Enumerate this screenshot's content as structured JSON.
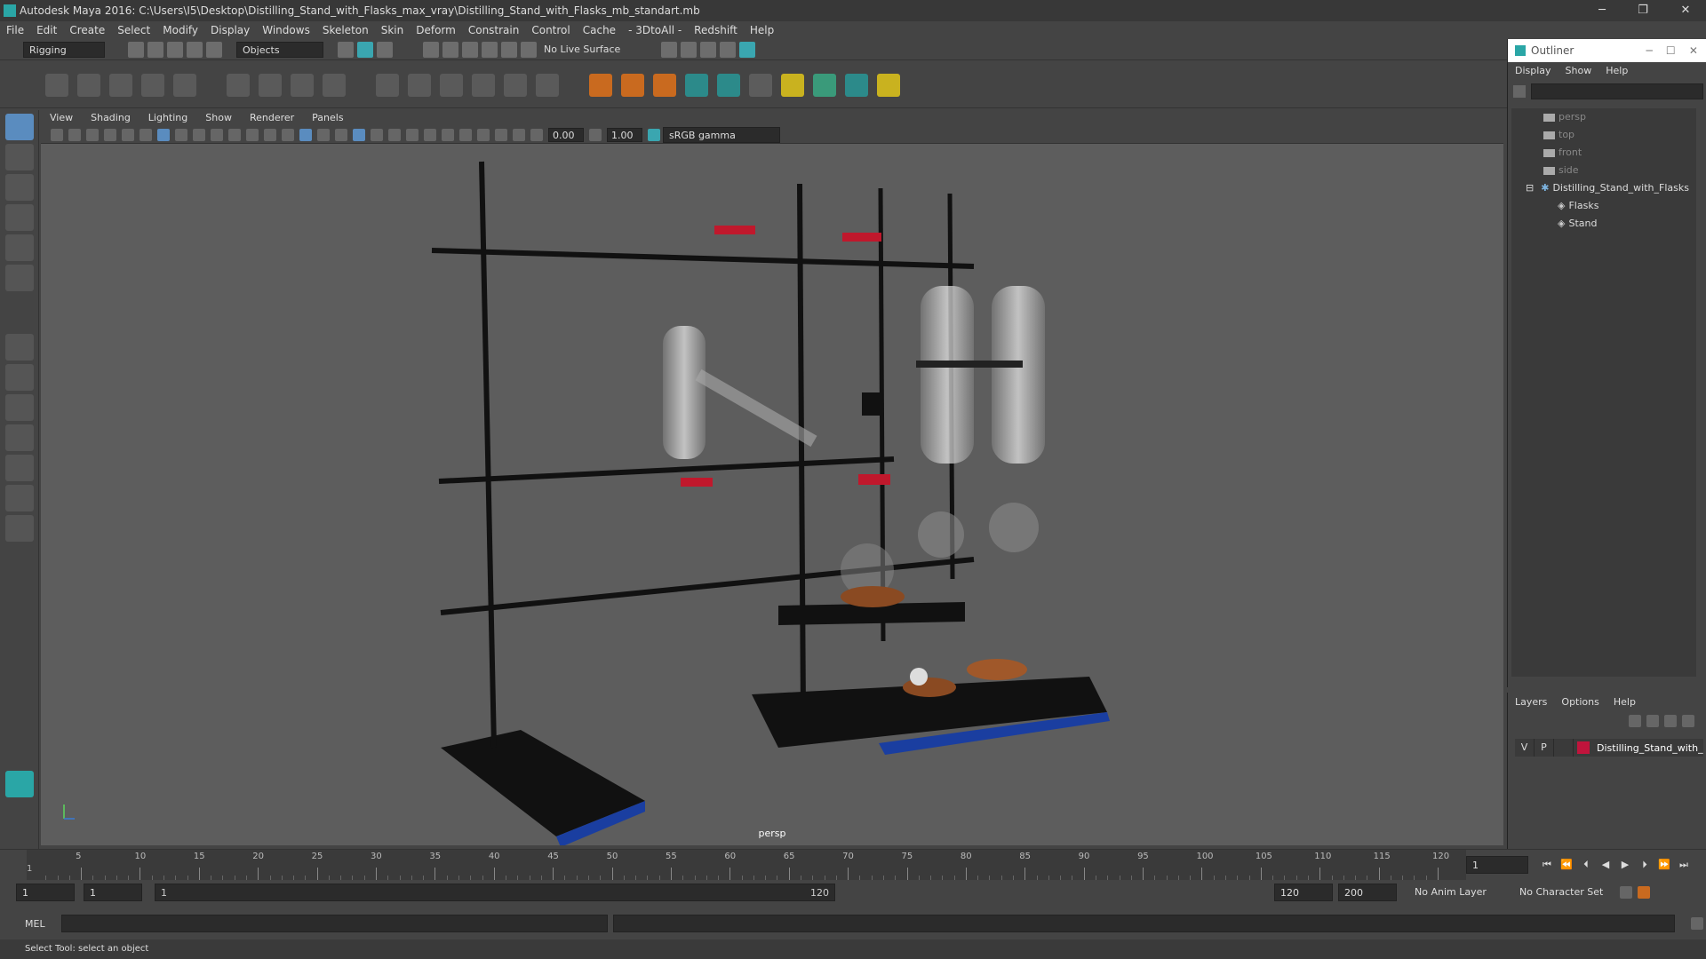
{
  "window": {
    "title": "Autodesk Maya 2016: C:\\Users\\I5\\Desktop\\Distilling_Stand_with_Flasks_max_vray\\Distilling_Stand_with_Flasks_mb_standart.mb",
    "min": "─",
    "max": "❐",
    "close": "✕"
  },
  "menubar": [
    "File",
    "Edit",
    "Create",
    "Select",
    "Modify",
    "Display",
    "Windows",
    "Skeleton",
    "Skin",
    "Deform",
    "Constrain",
    "Control",
    "Cache",
    "- 3DtoAll -",
    "Redshift",
    "Help"
  ],
  "statusline": {
    "mode": "Rigging",
    "selection_mask": "Objects",
    "live_surface": "No Live Surface"
  },
  "viewport": {
    "menus": [
      "View",
      "Shading",
      "Lighting",
      "Show",
      "Renderer",
      "Panels"
    ],
    "exposure": "0.00",
    "gamma": "1.00",
    "color_space": "sRGB gamma",
    "camera_label": "persp"
  },
  "outliner": {
    "title": "Outliner",
    "menus": [
      "Display",
      "Show",
      "Help"
    ],
    "items": [
      {
        "label": "persp",
        "type": "camera"
      },
      {
        "label": "top",
        "type": "camera"
      },
      {
        "label": "front",
        "type": "camera"
      },
      {
        "label": "side",
        "type": "camera"
      },
      {
        "label": "Distilling_Stand_with_Flasks",
        "type": "group"
      },
      {
        "label": "Flasks",
        "type": "mesh"
      },
      {
        "label": "Stand",
        "type": "mesh"
      }
    ]
  },
  "layers": {
    "menus": [
      "Layers",
      "Options",
      "Help"
    ],
    "row": {
      "v": "V",
      "p": "P",
      "name": "Distilling_Stand_with_",
      "color": "#c0143c"
    }
  },
  "timeline": {
    "ticks": [
      "5",
      "10",
      "15",
      "20",
      "25",
      "30",
      "35",
      "40",
      "45",
      "50",
      "55",
      "60",
      "65",
      "70",
      "75",
      "80",
      "85",
      "90",
      "95",
      "100",
      "105",
      "110",
      "115",
      "120"
    ],
    "first": "1",
    "current_frame": "1"
  },
  "range": {
    "start": "1",
    "playback_start": "1",
    "slider_start": "1",
    "slider_end": "120",
    "playback_end": "120",
    "end": "200",
    "anim_layer": "No Anim Layer",
    "character_set": "No Character Set"
  },
  "cmdline": {
    "label": "MEL"
  },
  "helpline": {
    "text": "Select Tool: select an object"
  }
}
